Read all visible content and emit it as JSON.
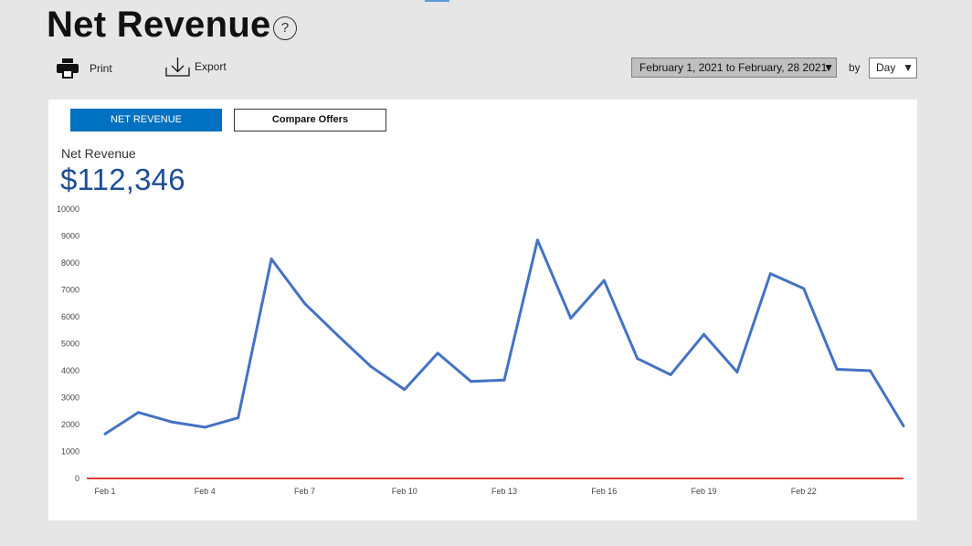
{
  "header": {
    "title": "Net Revenue",
    "help_symbol": "?"
  },
  "toolbar": {
    "print_label": "Print",
    "print_icon": "printer-icon",
    "export_label": "Export",
    "export_icon": "download-icon"
  },
  "filters": {
    "date_range": "February 1, 2021 to February, 28 2021",
    "by_label": "by",
    "interval": "Day"
  },
  "tabs": [
    {
      "label": "NET REVENUE",
      "active": true
    },
    {
      "label": "Compare Offers",
      "active": false
    }
  ],
  "summary": {
    "label": "Net Revenue",
    "value": "$112,346"
  },
  "colors": {
    "line": "#4472c4",
    "baseline": "#e03c31",
    "accent": "#0070c0",
    "value_text": "#1f4e96"
  },
  "chart_data": {
    "type": "line",
    "x": [
      "Feb 1",
      "Feb 2",
      "Feb 3",
      "Feb 4",
      "Feb 5",
      "Feb 6",
      "Feb 7",
      "Feb 8",
      "Feb 9",
      "Feb 10",
      "Feb 11",
      "Feb 12",
      "Feb 13",
      "Feb 14",
      "Feb 15",
      "Feb 16",
      "Feb 17",
      "Feb 18",
      "Feb 19",
      "Feb 20",
      "Feb 21",
      "Feb 22",
      "Feb 23",
      "Feb 24",
      "Feb 25"
    ],
    "x_tick_labels": [
      "Feb 1",
      "Feb 4",
      "Feb 7",
      "Feb 10",
      "Feb 13",
      "Feb 16",
      "Feb 19",
      "Feb 22"
    ],
    "series": [
      {
        "values": [
          1650,
          2450,
          2100,
          1900,
          2250,
          8150,
          6500,
          5300,
          4150,
          3300,
          4650,
          3600,
          3650,
          8850,
          5950,
          7350,
          4450,
          3850,
          5350,
          3950,
          7600,
          7050,
          4050,
          4000,
          1950
        ]
      }
    ],
    "y_ticks": [
      0,
      1000,
      2000,
      3000,
      4000,
      5000,
      6000,
      7000,
      8000,
      9000,
      10000
    ],
    "ylim": [
      0,
      10000
    ],
    "baseline_value": 0,
    "grid": false,
    "legend": "none",
    "title": "",
    "xlabel": "",
    "ylabel": ""
  }
}
